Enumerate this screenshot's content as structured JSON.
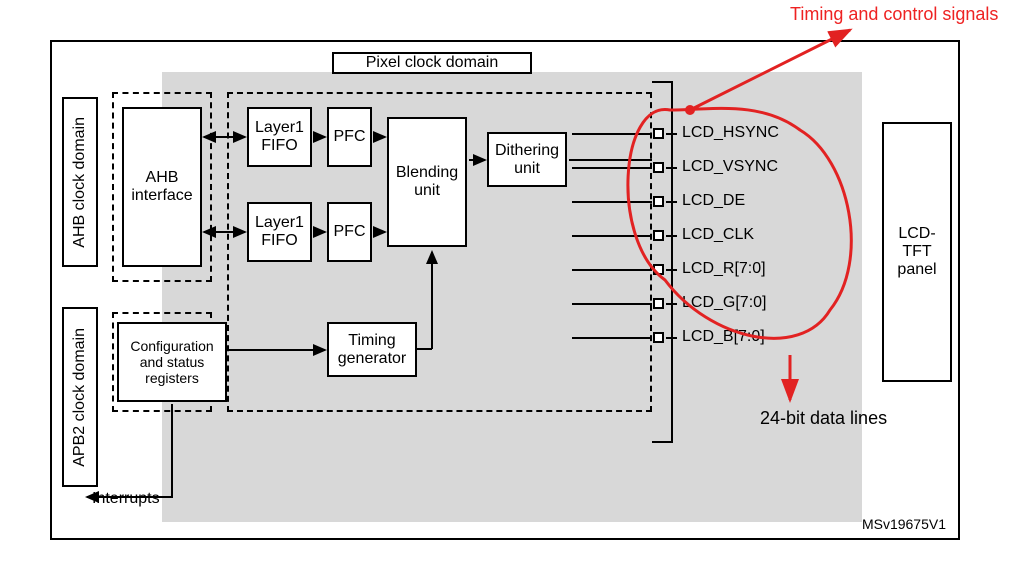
{
  "title": "Pixel clock domain",
  "domains": {
    "ahb": "AHB clock domain",
    "apb": "APB2 clock domain"
  },
  "blocks": {
    "ahb_if": "AHB interface",
    "layer1": "Layer1 FIFO",
    "layer2": "Layer1 FIFO",
    "pfc1": "PFC",
    "pfc2": "PFC",
    "blend": "Blending unit",
    "dither": "Dithering unit",
    "cfg": "Configuration and status registers",
    "timing": "Timing generator",
    "panel": "LCD-TFT panel"
  },
  "signals": [
    "LCD_HSYNC",
    "LCD_VSYNC",
    "LCD_DE",
    "LCD_CLK",
    "LCD_R[7:0]",
    "LCD_G[7:0]",
    "LCD_B[7:0]"
  ],
  "labels": {
    "interrupts": "Interrupts",
    "figure_id": "MSv19675V1"
  },
  "annotations": {
    "timing_ctrl": "Timing and control signals",
    "data_lines": "24-bit data lines"
  },
  "colors": {
    "red": "#e22222",
    "gray": "#d8d8d8"
  }
}
